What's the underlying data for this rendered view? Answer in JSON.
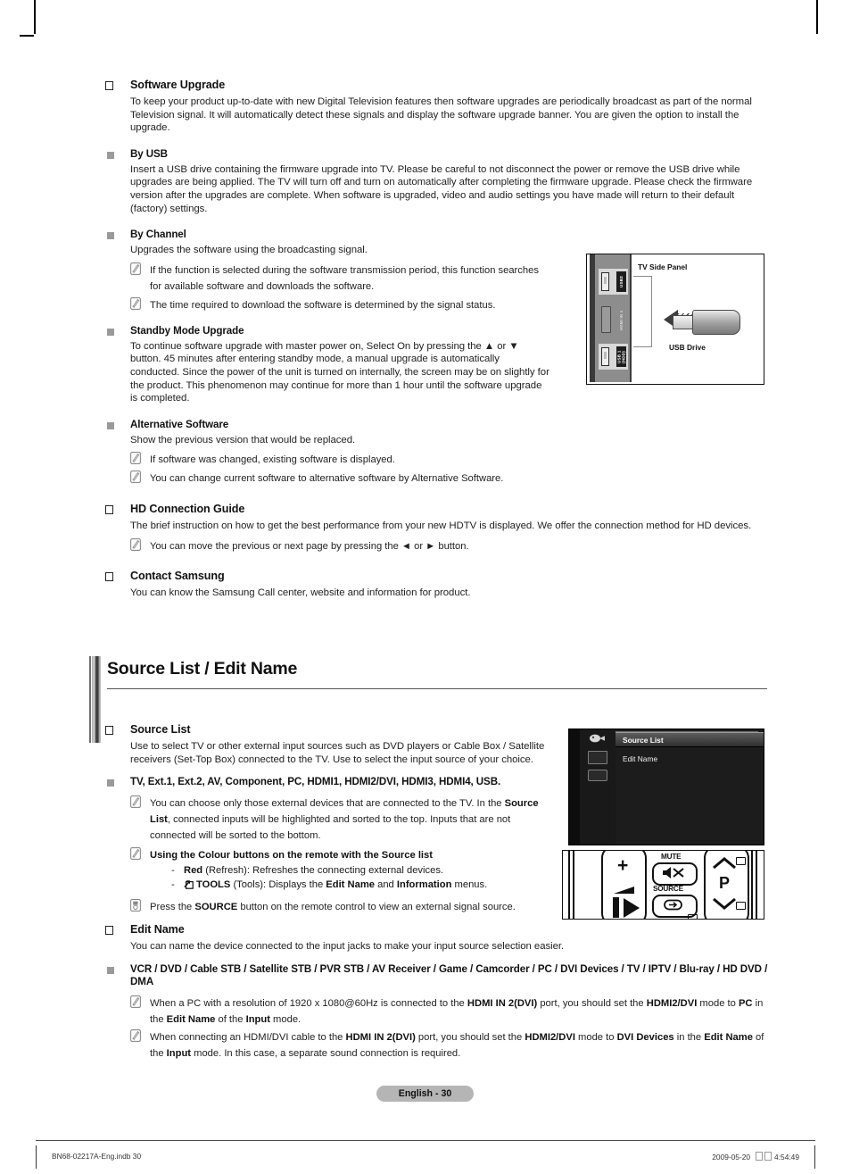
{
  "document": {
    "page_badge": "English - 30",
    "footer_left": "BN68-02217A-Eng.indb   30",
    "footer_right_date": "2009-05-20",
    "footer_right_time": "4:54:49"
  },
  "software_upgrade": {
    "heading": "Software Upgrade",
    "intro": "To keep your product up-to-date with new Digital Television features then software upgrades are periodically broadcast as part of the normal Television signal. It will automatically detect these signals and display the software upgrade banner. You are given the option to install the upgrade.",
    "by_usb": {
      "heading": "By USB",
      "body": "Insert a USB drive containing the firmware upgrade into TV. Please be careful to not disconnect the power or remove the USB drive while upgrades are being applied. The TV will turn off and turn on automatically after completing the firmware upgrade. Please check the firmware version after the upgrades are complete. When software is upgraded, video and audio settings you have made will return to their default (factory) settings."
    },
    "by_channel": {
      "heading": "By Channel",
      "body": "Upgrades the software using the broadcasting signal.",
      "notes": [
        "If the function is selected during the software transmission period, this function searches for available software and downloads the software.",
        "The time required to download the software is determined by the signal status."
      ]
    },
    "standby_mode": {
      "heading": "Standby Mode Upgrade",
      "body": "To continue software upgrade with master power on, Select On by pressing the ▲ or ▼ button. 45 minutes after entering standby mode, a manual upgrade is automatically conducted. Since the power of the unit is turned on internally, the screen may be on slightly for the product. This phenomenon may continue for more than 1 hour until the software upgrade is completed."
    },
    "alternative_software": {
      "heading": "Alternative Software",
      "body": "Show the previous version that would be replaced.",
      "notes": [
        "If software was changed, existing software is displayed.",
        "You can change current software to alternative software by Alternative Software."
      ]
    }
  },
  "hd_connection_guide": {
    "heading": "HD Connection Guide",
    "body": "The brief instruction on how to get the best performance from your new HDTV is displayed. We offer the connection method for HD devices.",
    "note": "You can move the previous or next page by pressing the ◄ or ► button."
  },
  "contact_samsung": {
    "heading": "Contact Samsung",
    "body": "You can know the Samsung Call center, website and information for product."
  },
  "usb_figure": {
    "title": "TV Side Panel",
    "drive_label": "USB Drive",
    "ports": [
      {
        "label": "USB2"
      },
      {
        "label": "HDMI IN 4"
      },
      {
        "label": "USB 1 (HDD)"
      }
    ]
  },
  "section": {
    "title": "Source List / Edit Name"
  },
  "source_list": {
    "heading": "Source List",
    "body": "Use to select TV or other external input sources such as DVD players or Cable Box / Satellite receivers (Set-Top Box) connected to the TV. Use to select the input source of your choice.",
    "inputs_heading": "TV, Ext.1, Ext.2, AV, Component, PC, HDMI1, HDMI2/DVI, HDMI3, HDMI4, USB.",
    "note_connected_1": "You can choose only those external devices that are connected to the TV. In the ",
    "note_connected_bold": "Source List",
    "note_connected_2": ", connected inputs will be highlighted and sorted to the top. Inputs that are not connected will be sorted to the bottom.",
    "colour_buttons_heading": "Using the Colour buttons on the remote with the Source list",
    "red_bold": "Red",
    "red_rest": " (Refresh): Refreshes the connecting external devices.",
    "tools_bold": "TOOLS",
    "tools_rest_1": " (Tools): Displays the ",
    "tools_editname": "Edit Name",
    "tools_rest_2": " and ",
    "tools_information": "Information",
    "tools_rest_3": " menus.",
    "source_press_1": "Press the ",
    "source_press_bold": "SOURCE",
    "source_press_2": " button on the remote control to view an external signal source."
  },
  "osd_menu": {
    "rail_label": "Input",
    "items": [
      {
        "label": "Source List",
        "selected": true
      },
      {
        "label": "Edit Name",
        "selected": false
      }
    ]
  },
  "remote": {
    "mute_label": "MUTE",
    "source_label": "SOURCE",
    "channel_label": "P",
    "volume_plus": "+",
    "volume_minus": "–"
  },
  "edit_name": {
    "heading": "Edit Name",
    "body": "You can name the device connected to the input jacks to make your input source selection easier.",
    "device_list": "VCR / DVD / Cable STB / Satellite STB / PVR STB / AV Receiver / Game / Camcorder / PC / DVI Devices / TV / IPTV / Blu-ray / HD DVD / DMA",
    "note1": {
      "t1": "When a PC with a resolution of 1920 x 1080@60Hz is connected to the ",
      "b1": "HDMI IN 2(DVI)",
      "t2": "  port, you should set the ",
      "b2": "HDMI2/DVI",
      "t3": " mode to ",
      "b3": "PC",
      "t4": " in the ",
      "b4": "Edit Name",
      "t5": " of the ",
      "b5": "Input",
      "t6": " mode."
    },
    "note2": {
      "t1": "When connecting an HDMI/DVI cable to the ",
      "b1": "HDMI IN 2(DVI)",
      "t2": " port, you should set the ",
      "b2": "HDMI2/DVI",
      "t3": " mode to ",
      "b3": "DVI Devices",
      "t4": " in the ",
      "b4": "Edit Name",
      "t5": " of the ",
      "b5": "Input",
      "t6": " mode. In this case, a separate sound connection is required."
    }
  }
}
